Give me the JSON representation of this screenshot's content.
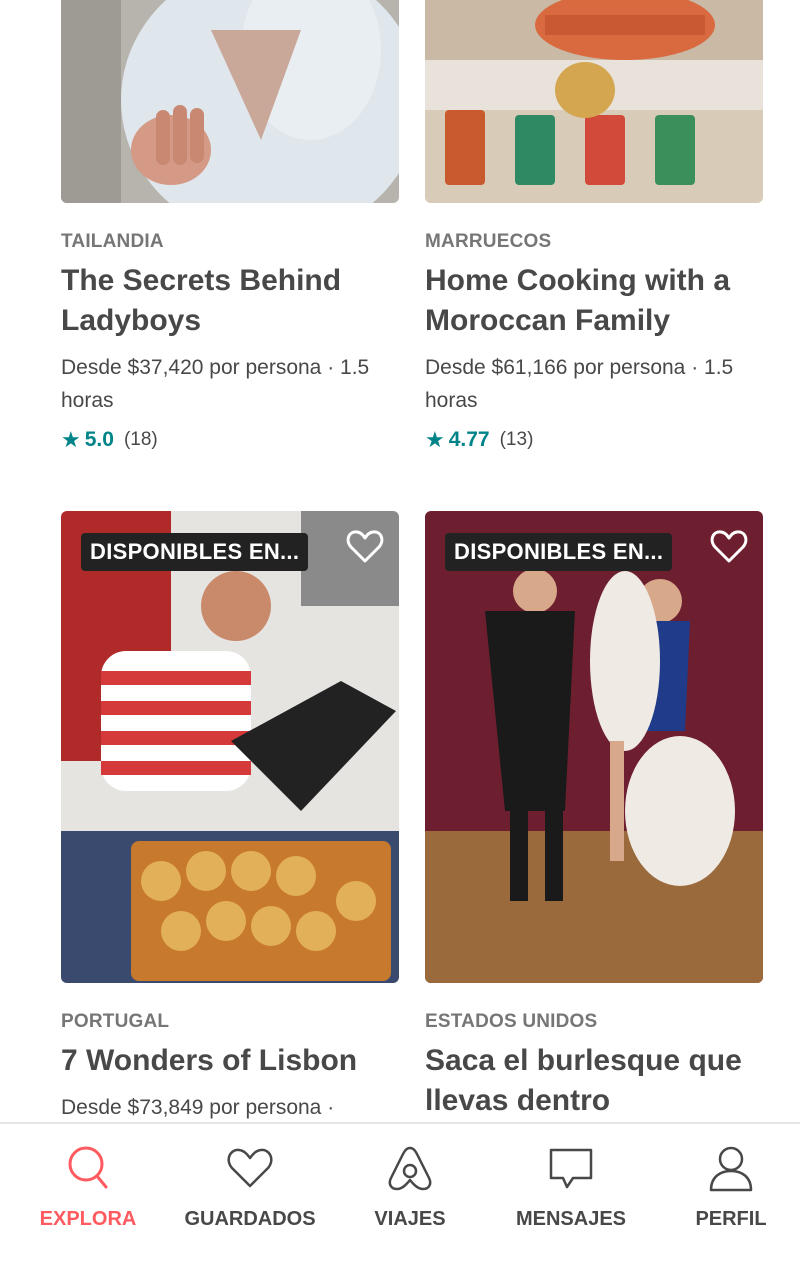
{
  "cards": [
    {
      "country": "TAILANDIA",
      "title": "The Secrets Behind Ladyboys",
      "price": "Desde $37,420 por persona · 1.5 horas",
      "rating": "5.0",
      "reviews": "(18)"
    },
    {
      "country": "MARRUECOS",
      "title": "Home Cooking with a Moroccan Family",
      "price": "Desde $61,166 por persona · 1.5 horas",
      "rating": "4.77",
      "reviews": "(13)"
    },
    {
      "badge": "DISPONIBLES EN...",
      "country": "PORTUGAL",
      "title": "7 Wonders of Lisbon",
      "price": "Desde $73,849 por persona ·"
    },
    {
      "badge": "DISPONIBLES EN...",
      "country": "ESTADOS UNIDOS",
      "title": "Saca el burlesque que llevas dentro"
    }
  ],
  "tabs": [
    {
      "label": "EXPLORA",
      "icon": "search-icon",
      "active": true
    },
    {
      "label": "GUARDADOS",
      "icon": "heart-icon"
    },
    {
      "label": "VIAJES",
      "icon": "airbnb-logo-icon"
    },
    {
      "label": "MENSAJES",
      "icon": "message-icon"
    },
    {
      "label": "PERFIL",
      "icon": "profile-icon"
    }
  ],
  "colors": {
    "accent": "#FF5A5F",
    "rating": "#008489",
    "text": "#484848",
    "muted": "#767676"
  }
}
